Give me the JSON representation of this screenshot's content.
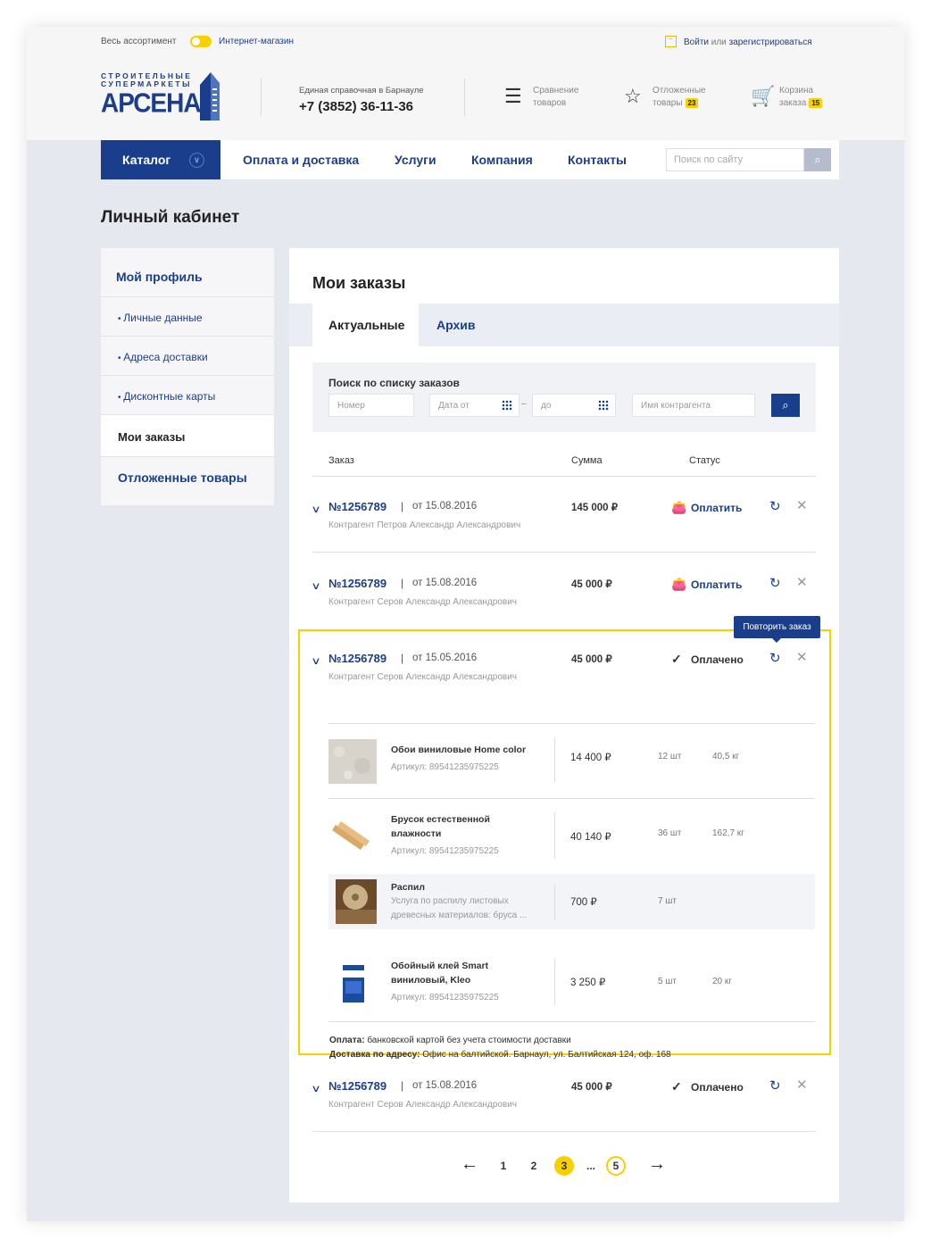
{
  "topbar": {
    "assortment": "Весь ассортимент",
    "shop": "Интернет-магазин",
    "login": "Войти",
    "or": "или",
    "register": "зарегистрироваться"
  },
  "header": {
    "logo_small": "СТРОИТЕЛЬНЫЕ",
    "logo_small2": "СУПЕРМАРКЕТЫ",
    "logo_big": "АРСЕНАЛ",
    "phone_label": "Единая справочная в Барнауле",
    "phone": "+7 (3852) 36-11-36",
    "compare_1": "Сравнение",
    "compare_2": "товаров",
    "postponed_1": "Отложенные",
    "postponed_2": "товары",
    "postponed_count": "23",
    "cart_1": "Корзина",
    "cart_2": "заказа",
    "cart_count": "15"
  },
  "nav": {
    "catalog": "Каталог",
    "links": [
      "Оплата и доставка",
      "Услуги",
      "Компания",
      "Контакты"
    ],
    "search_placeholder": "Поиск по сайту"
  },
  "page_title": "Личный кабинет",
  "sidebar": {
    "profile": "Мой профиль",
    "items": [
      "Личные данные",
      "Адреса доставки",
      "Дисконтные карты"
    ],
    "orders": "Мои заказы",
    "postponed": "Отложенные товары"
  },
  "main": {
    "title": "Мои заказы",
    "tabs": [
      "Актуальные",
      "Архив"
    ],
    "filter": {
      "label": "Поиск по списку заказов",
      "number": "Номер",
      "date_from": "Дата от",
      "date_to": "до",
      "counterparty": "Имя контрагента"
    },
    "columns": [
      "Заказ",
      "Сумма",
      "Статус"
    ],
    "tooltip": "Повторить заказ",
    "orders": [
      {
        "num": "№1256789",
        "sep": "|",
        "date": "от 15.08.2016",
        "counterparty": "Контрагент Петров Александр Александрович",
        "sum": "145 000 ₽",
        "status": "Оплатить"
      },
      {
        "num": "№1256789",
        "sep": "|",
        "date": "от 15.08.2016",
        "counterparty": "Контрагент Серов Александр Александрович",
        "sum": "45 000 ₽",
        "status": "Оплатить"
      },
      {
        "num": "№1256789",
        "sep": "|",
        "date": "от 15.05.2016",
        "counterparty": "Контрагент Серов Александр Александрович",
        "sum": "45 000 ₽",
        "status": "Оплачено"
      },
      {
        "num": "№1256789",
        "sep": "|",
        "date": "от 15.08.2016",
        "counterparty": "Контрагент Серов Александр Александрович",
        "sum": "45 000 ₽",
        "status": "Оплачено"
      }
    ],
    "products": [
      {
        "name": "Обои виниловые Home color",
        "sub": "Артикул: 89541235975225",
        "price": "14 400 ₽",
        "qty": "12 шт",
        "weight": "40,5 кг"
      },
      {
        "name": "Брусок естественной влажности",
        "sub": "Артикул: 89541235975225",
        "price": "40 140 ₽",
        "qty": "36 шт",
        "weight": "162,7 кг"
      },
      {
        "name": "Распил",
        "sub": "Услуга по распилу листовых древесных материалов: бруса ...",
        "price": "700 ₽",
        "qty": "7 шт",
        "weight": ""
      },
      {
        "name": "Обойный клей Smart виниловый, Kleo",
        "sub": "Артикул: 89541235975225",
        "price": "3 250 ₽",
        "qty": "5 шт",
        "weight": "20 кг"
      }
    ],
    "payment_label": "Оплата:",
    "payment_value": "банковской картой без учета стоимости доставки",
    "delivery_label": "Доставка по адресу:",
    "delivery_value": "Офис на балтийской. Барнаул, ул. Балтийская 124, оф. 168",
    "pager": [
      "1",
      "2",
      "3",
      "...",
      "5"
    ]
  }
}
